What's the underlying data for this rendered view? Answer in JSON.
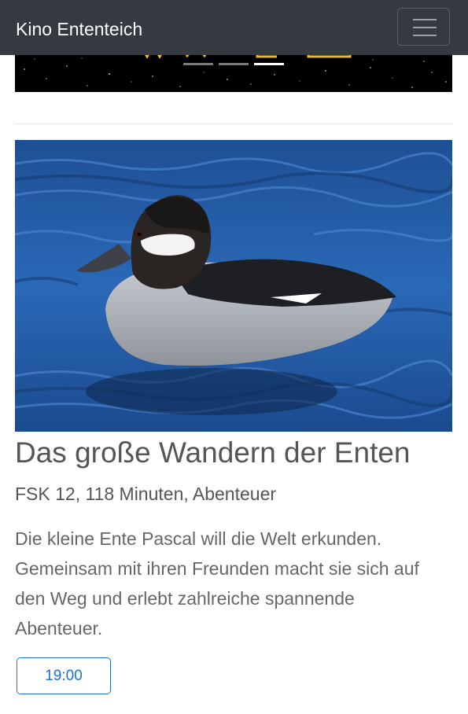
{
  "navbar": {
    "brand": "Kino Ententeich",
    "toggler_icon": "hamburger-menu-icon"
  },
  "carousel": {
    "slide_count": 3,
    "active_slide": 3
  },
  "movie": {
    "title": "Das große Wandern der Enten",
    "meta": "FSK 12, 118 Minuten, Abenteuer",
    "description": "Die kleine Ente Pascal will die Welt erkunden. Gemeinsam mit ihren Freunden macht sie sich auf den Weg und erlebt zahlreiche spannende Abenteuer.",
    "showtimes": [
      "19:00"
    ]
  },
  "colors": {
    "navbar_bg": "#343a40",
    "accent": "#1a6fd8",
    "text": "#555555"
  }
}
